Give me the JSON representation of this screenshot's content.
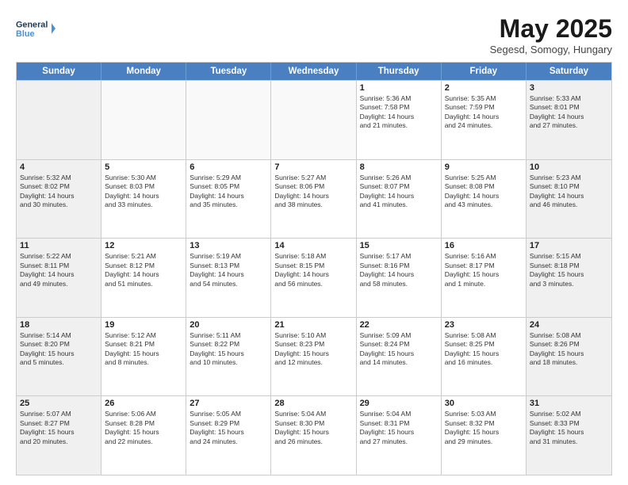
{
  "logo": {
    "line1": "General",
    "line2": "Blue"
  },
  "title": "May 2025",
  "location": "Segesd, Somogy, Hungary",
  "days_of_week": [
    "Sunday",
    "Monday",
    "Tuesday",
    "Wednesday",
    "Thursday",
    "Friday",
    "Saturday"
  ],
  "weeks": [
    [
      {
        "day": "",
        "info": ""
      },
      {
        "day": "",
        "info": ""
      },
      {
        "day": "",
        "info": ""
      },
      {
        "day": "",
        "info": ""
      },
      {
        "day": "1",
        "info": "Sunrise: 5:36 AM\nSunset: 7:58 PM\nDaylight: 14 hours\nand 21 minutes."
      },
      {
        "day": "2",
        "info": "Sunrise: 5:35 AM\nSunset: 7:59 PM\nDaylight: 14 hours\nand 24 minutes."
      },
      {
        "day": "3",
        "info": "Sunrise: 5:33 AM\nSunset: 8:01 PM\nDaylight: 14 hours\nand 27 minutes."
      }
    ],
    [
      {
        "day": "4",
        "info": "Sunrise: 5:32 AM\nSunset: 8:02 PM\nDaylight: 14 hours\nand 30 minutes."
      },
      {
        "day": "5",
        "info": "Sunrise: 5:30 AM\nSunset: 8:03 PM\nDaylight: 14 hours\nand 33 minutes."
      },
      {
        "day": "6",
        "info": "Sunrise: 5:29 AM\nSunset: 8:05 PM\nDaylight: 14 hours\nand 35 minutes."
      },
      {
        "day": "7",
        "info": "Sunrise: 5:27 AM\nSunset: 8:06 PM\nDaylight: 14 hours\nand 38 minutes."
      },
      {
        "day": "8",
        "info": "Sunrise: 5:26 AM\nSunset: 8:07 PM\nDaylight: 14 hours\nand 41 minutes."
      },
      {
        "day": "9",
        "info": "Sunrise: 5:25 AM\nSunset: 8:08 PM\nDaylight: 14 hours\nand 43 minutes."
      },
      {
        "day": "10",
        "info": "Sunrise: 5:23 AM\nSunset: 8:10 PM\nDaylight: 14 hours\nand 46 minutes."
      }
    ],
    [
      {
        "day": "11",
        "info": "Sunrise: 5:22 AM\nSunset: 8:11 PM\nDaylight: 14 hours\nand 49 minutes."
      },
      {
        "day": "12",
        "info": "Sunrise: 5:21 AM\nSunset: 8:12 PM\nDaylight: 14 hours\nand 51 minutes."
      },
      {
        "day": "13",
        "info": "Sunrise: 5:19 AM\nSunset: 8:13 PM\nDaylight: 14 hours\nand 54 minutes."
      },
      {
        "day": "14",
        "info": "Sunrise: 5:18 AM\nSunset: 8:15 PM\nDaylight: 14 hours\nand 56 minutes."
      },
      {
        "day": "15",
        "info": "Sunrise: 5:17 AM\nSunset: 8:16 PM\nDaylight: 14 hours\nand 58 minutes."
      },
      {
        "day": "16",
        "info": "Sunrise: 5:16 AM\nSunset: 8:17 PM\nDaylight: 15 hours\nand 1 minute."
      },
      {
        "day": "17",
        "info": "Sunrise: 5:15 AM\nSunset: 8:18 PM\nDaylight: 15 hours\nand 3 minutes."
      }
    ],
    [
      {
        "day": "18",
        "info": "Sunrise: 5:14 AM\nSunset: 8:20 PM\nDaylight: 15 hours\nand 5 minutes."
      },
      {
        "day": "19",
        "info": "Sunrise: 5:12 AM\nSunset: 8:21 PM\nDaylight: 15 hours\nand 8 minutes."
      },
      {
        "day": "20",
        "info": "Sunrise: 5:11 AM\nSunset: 8:22 PM\nDaylight: 15 hours\nand 10 minutes."
      },
      {
        "day": "21",
        "info": "Sunrise: 5:10 AM\nSunset: 8:23 PM\nDaylight: 15 hours\nand 12 minutes."
      },
      {
        "day": "22",
        "info": "Sunrise: 5:09 AM\nSunset: 8:24 PM\nDaylight: 15 hours\nand 14 minutes."
      },
      {
        "day": "23",
        "info": "Sunrise: 5:08 AM\nSunset: 8:25 PM\nDaylight: 15 hours\nand 16 minutes."
      },
      {
        "day": "24",
        "info": "Sunrise: 5:08 AM\nSunset: 8:26 PM\nDaylight: 15 hours\nand 18 minutes."
      }
    ],
    [
      {
        "day": "25",
        "info": "Sunrise: 5:07 AM\nSunset: 8:27 PM\nDaylight: 15 hours\nand 20 minutes."
      },
      {
        "day": "26",
        "info": "Sunrise: 5:06 AM\nSunset: 8:28 PM\nDaylight: 15 hours\nand 22 minutes."
      },
      {
        "day": "27",
        "info": "Sunrise: 5:05 AM\nSunset: 8:29 PM\nDaylight: 15 hours\nand 24 minutes."
      },
      {
        "day": "28",
        "info": "Sunrise: 5:04 AM\nSunset: 8:30 PM\nDaylight: 15 hours\nand 26 minutes."
      },
      {
        "day": "29",
        "info": "Sunrise: 5:04 AM\nSunset: 8:31 PM\nDaylight: 15 hours\nand 27 minutes."
      },
      {
        "day": "30",
        "info": "Sunrise: 5:03 AM\nSunset: 8:32 PM\nDaylight: 15 hours\nand 29 minutes."
      },
      {
        "day": "31",
        "info": "Sunrise: 5:02 AM\nSunset: 8:33 PM\nDaylight: 15 hours\nand 31 minutes."
      }
    ]
  ]
}
